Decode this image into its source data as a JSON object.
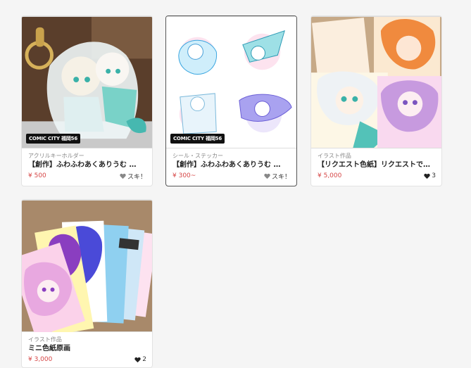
{
  "items": [
    {
      "category": "アクリルキーホルダー",
      "title": "【創作】ふわふわあくありうむ アクリルキーホルダー",
      "price": "¥ 500",
      "like": "スキ！",
      "liked": false,
      "badge": "COMIC CITY 福岡56",
      "image": "acrylic-keychain-photo"
    },
    {
      "category": "シール・ステッカー",
      "title": "【創作】ふわふわあくありうむ ステッカー",
      "price": "¥ 300~",
      "like": "スキ！",
      "liked": false,
      "badge": "COMIC CITY 福岡56",
      "image": "sticker-sheet"
    },
    {
      "category": "イラスト作品",
      "title": "【リクエスト色紙】リクエストで描きます",
      "price": "¥ 5,000",
      "like": "3",
      "liked": true,
      "image": "shikishi-collage"
    },
    {
      "category": "イラスト作品",
      "title": "ミニ色紙原画",
      "price": "¥ 3,000",
      "like": "2",
      "liked": true,
      "image": "mini-shikishi-fan"
    }
  ],
  "colors": {
    "price": "#d64545",
    "accent_teal": "#48c9c4",
    "accent_pink": "#f49ac9",
    "accent_purple": "#8c6ee0"
  }
}
